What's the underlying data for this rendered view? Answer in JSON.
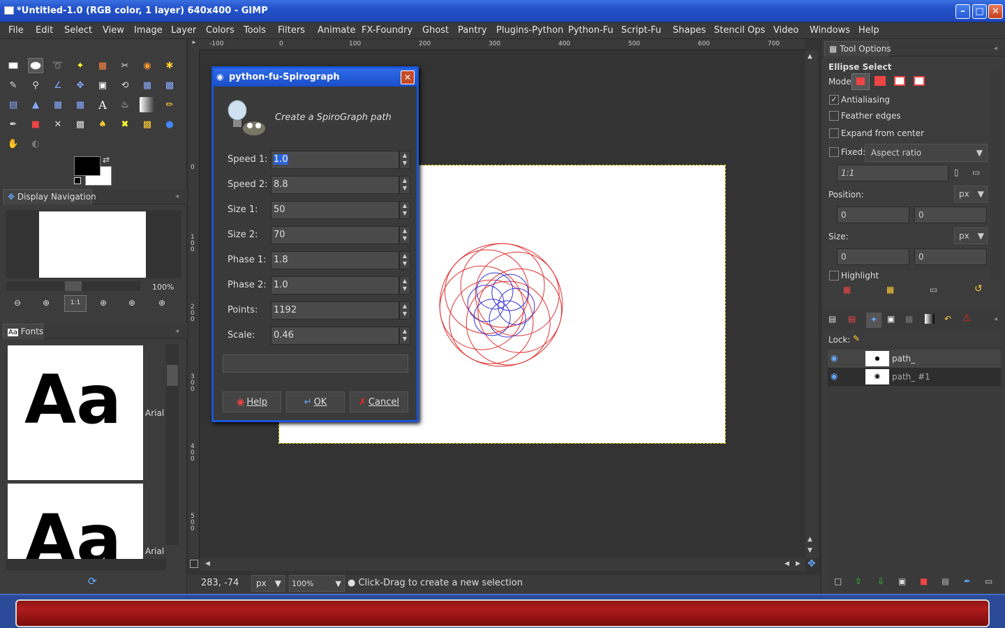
{
  "window": {
    "title": "*Untitled-1.0 (RGB color, 1 layer) 640x400 - GIMP"
  },
  "menu": [
    "File",
    "Edit",
    "Select",
    "View",
    "Image",
    "Layer",
    "Colors",
    "Tools",
    "Filters",
    "Animate",
    "FX-Foundry",
    "Ghost",
    "Pantry",
    "Plugins-Python",
    "Python-Fu",
    "Script-Fu",
    "Shapes",
    "Stencil Ops",
    "Video",
    "Windows",
    "Help"
  ],
  "nav": {
    "tab": "Display Navigation",
    "zoom": "100%"
  },
  "fonts": {
    "tab": "Fonts",
    "sample": "Aa",
    "items": [
      "Arial",
      "Arial"
    ]
  },
  "ruler": {
    "h": [
      "-100",
      "0",
      "100",
      "200",
      "300",
      "400",
      "500",
      "600",
      "700"
    ],
    "v": [
      "0",
      "1\n0\n0",
      "2\n0\n0",
      "3\n0\n0",
      "4\n0\n0",
      "5\n0\n0"
    ]
  },
  "status": {
    "coords": "283, -74",
    "unit": "px",
    "zoom": "100",
    "zoom_suffix": "%",
    "message": "Click-Drag to create a new selection"
  },
  "dialog": {
    "title": "python-fu-Spirograph",
    "heading": "Create a SpiroGraph path",
    "params": [
      {
        "label": "Speed 1:",
        "value": "1.0"
      },
      {
        "label": "Speed 2:",
        "value": "8.8"
      },
      {
        "label": "Size 1:",
        "value": "50"
      },
      {
        "label": "Size 2:",
        "value": "70"
      },
      {
        "label": "Phase 1:",
        "value": "1.8"
      },
      {
        "label": "Phase 2:",
        "value": "1.0"
      },
      {
        "label": "Points:",
        "value": "1192"
      },
      {
        "label": "Scale:",
        "value": "0.46"
      }
    ],
    "buttons": {
      "help": "Help",
      "ok": "OK",
      "cancel": "Cancel"
    }
  },
  "tool_options": {
    "tab": "Tool Options",
    "tool": "Ellipse Select",
    "mode_label": "Mode:",
    "antialiasing": "Antialiasing",
    "feather": "Feather edges",
    "expand": "Expand from center",
    "fixed": "Fixed:",
    "fixed_value": "Aspect ratio",
    "ratio": "1:1",
    "position": "Position:",
    "size": "Size:",
    "unit": "px",
    "pos_x": "0",
    "pos_y": "0",
    "size_x": "0",
    "size_y": "0",
    "highlight": "Highlight"
  },
  "layers": {
    "lock": "Lock:",
    "items": [
      "path_",
      "path_ #1"
    ]
  },
  "colors": {
    "accent": "#1a55d8",
    "spiro_red": "#e03030",
    "spiro_blue": "#3030d0"
  }
}
